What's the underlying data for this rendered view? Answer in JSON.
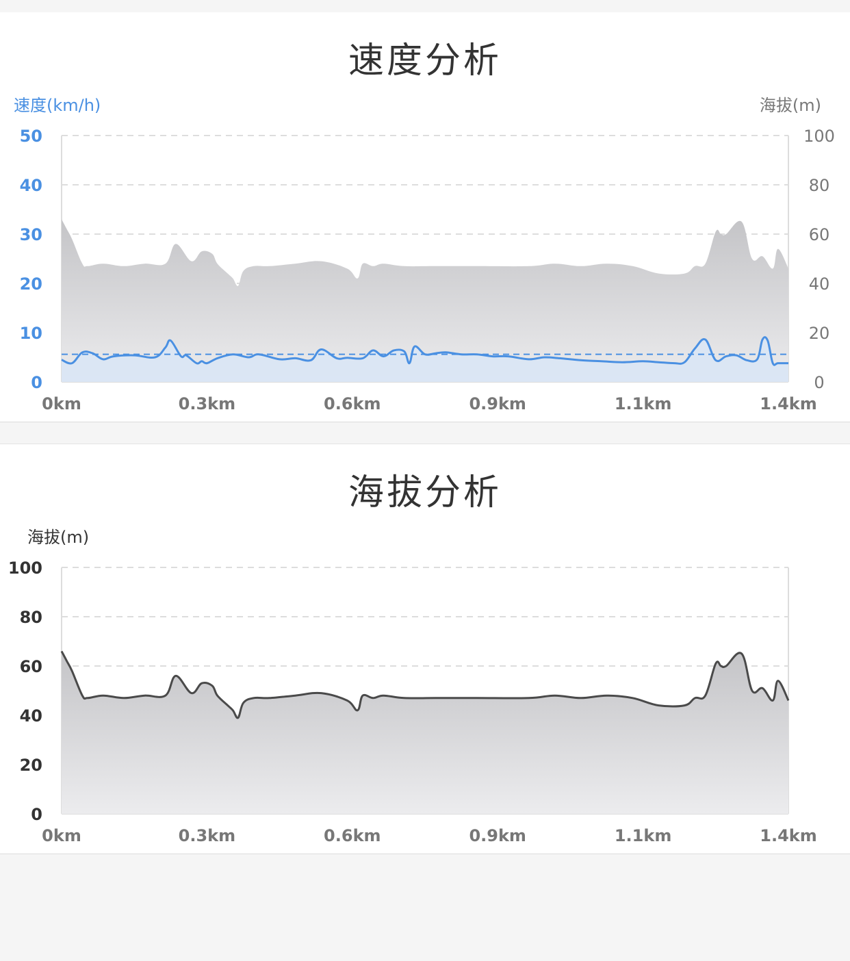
{
  "colors": {
    "speed_blue": "#4a90e2",
    "speed_fill": "#d9e6f5",
    "altitude_fill_top": "#c4c4c7",
    "altitude_fill_bottom": "#ececee",
    "altitude_line": "#4a4a4a",
    "grid": "#dddddd",
    "gray_text": "#777777",
    "dark_text": "#333333"
  },
  "chart_data": [
    {
      "id": "speed",
      "type": "line",
      "title": "速度分析",
      "xlabel": "",
      "x_ticks": [
        "0km",
        "0.3km",
        "0.6km",
        "0.9km",
        "1.1km",
        "1.4km"
      ],
      "y_left": {
        "label": "速度(km/h)",
        "ticks": [
          "0",
          "10",
          "20",
          "30",
          "40",
          "50"
        ],
        "lim": [
          0,
          50
        ]
      },
      "y_right": {
        "label": "海拔(m)",
        "ticks": [
          "0",
          "20",
          "40",
          "60",
          "80",
          "100"
        ],
        "lim": [
          0,
          100
        ]
      },
      "x_range": [
        0,
        1.4
      ],
      "grid": true,
      "average_speed": 5.6,
      "series": [
        {
          "axis": "right",
          "style": "area",
          "x": [
            0,
            0.01,
            0.02,
            0.04,
            0.05,
            0.08,
            0.12,
            0.16,
            0.2,
            0.22,
            0.25,
            0.27,
            0.29,
            0.3,
            0.32,
            0.33,
            0.34,
            0.35,
            0.37,
            0.4,
            0.45,
            0.5,
            0.55,
            0.57,
            0.58,
            0.6,
            0.62,
            0.66,
            0.72,
            0.8,
            0.9,
            0.95,
            1.0,
            1.05,
            1.1,
            1.15,
            1.2,
            1.22,
            1.24,
            1.26,
            1.27,
            1.28,
            1.31,
            1.33,
            1.35,
            1.37,
            1.38,
            1.4
          ],
          "values": [
            66,
            62,
            58,
            48,
            47,
            48,
            47,
            48,
            48,
            56,
            49,
            53,
            52,
            48,
            44,
            42,
            39,
            45,
            47,
            47,
            48,
            49,
            46,
            42,
            48,
            47,
            48,
            47,
            47,
            47,
            47,
            48,
            47,
            48,
            47,
            44,
            44,
            47,
            48,
            61,
            60,
            60,
            65,
            50,
            51,
            46,
            54,
            46
          ]
        },
        {
          "axis": "left",
          "style": "line",
          "x": [
            0,
            0.02,
            0.04,
            0.06,
            0.08,
            0.1,
            0.14,
            0.18,
            0.2,
            0.21,
            0.23,
            0.24,
            0.26,
            0.27,
            0.28,
            0.3,
            0.33,
            0.36,
            0.38,
            0.42,
            0.45,
            0.48,
            0.5,
            0.53,
            0.55,
            0.58,
            0.6,
            0.62,
            0.64,
            0.66,
            0.67,
            0.68,
            0.7,
            0.72,
            0.74,
            0.77,
            0.8,
            0.83,
            0.86,
            0.9,
            0.93,
            0.96,
            1.0,
            1.04,
            1.08,
            1.12,
            1.15,
            1.18,
            1.2,
            1.22,
            1.24,
            1.26,
            1.28,
            1.3,
            1.32,
            1.34,
            1.35,
            1.36,
            1.37,
            1.38,
            1.4
          ],
          "values": [
            4.5,
            3.8,
            6.0,
            5.8,
            4.6,
            5.2,
            5.4,
            5.0,
            7.0,
            8.4,
            5.2,
            5.4,
            3.8,
            4.2,
            3.8,
            4.8,
            5.6,
            5.0,
            5.6,
            4.6,
            4.8,
            4.4,
            6.6,
            4.8,
            4.9,
            4.8,
            6.4,
            5.2,
            6.4,
            6.2,
            3.8,
            7.2,
            5.6,
            5.8,
            6.0,
            5.6,
            5.6,
            5.2,
            5.2,
            4.6,
            5.0,
            4.8,
            4.4,
            4.2,
            4.0,
            4.2,
            4.0,
            3.8,
            4.0,
            6.8,
            8.6,
            4.4,
            5.2,
            5.4,
            4.4,
            4.6,
            8.6,
            8.4,
            3.8,
            3.8,
            3.8
          ]
        }
      ]
    },
    {
      "id": "elevation",
      "type": "area",
      "title": "海拔分析",
      "xlabel": "",
      "x_ticks": [
        "0km",
        "0.3km",
        "0.6km",
        "0.9km",
        "1.1km",
        "1.4km"
      ],
      "y_left": {
        "label": "海拔(m)",
        "ticks": [
          "0",
          "20",
          "40",
          "60",
          "80",
          "100"
        ],
        "lim": [
          0,
          100
        ]
      },
      "x_range": [
        0,
        1.4
      ],
      "grid": true,
      "series": [
        {
          "axis": "left",
          "style": "area",
          "x": [
            0,
            0.01,
            0.02,
            0.04,
            0.05,
            0.08,
            0.12,
            0.16,
            0.2,
            0.22,
            0.25,
            0.27,
            0.29,
            0.3,
            0.32,
            0.33,
            0.34,
            0.35,
            0.37,
            0.4,
            0.45,
            0.5,
            0.55,
            0.57,
            0.58,
            0.6,
            0.62,
            0.66,
            0.72,
            0.8,
            0.9,
            0.95,
            1.0,
            1.05,
            1.1,
            1.15,
            1.2,
            1.22,
            1.24,
            1.26,
            1.27,
            1.28,
            1.31,
            1.33,
            1.35,
            1.37,
            1.38,
            1.4
          ],
          "values": [
            66,
            62,
            58,
            48,
            47,
            48,
            47,
            48,
            48,
            56,
            49,
            53,
            52,
            48,
            44,
            42,
            39,
            45,
            47,
            47,
            48,
            49,
            46,
            42,
            48,
            47,
            48,
            47,
            47,
            47,
            47,
            48,
            47,
            48,
            47,
            44,
            44,
            47,
            48,
            61,
            60,
            60,
            65,
            50,
            51,
            46,
            54,
            46
          ]
        }
      ]
    }
  ]
}
